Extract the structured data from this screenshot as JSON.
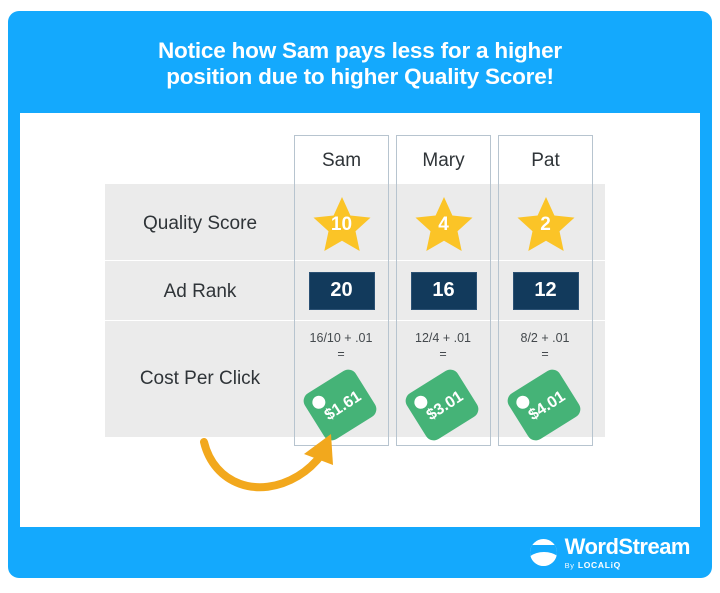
{
  "header": {
    "title_line1": "Notice how Sam pays less for a higher",
    "title_line2": "position due to higher Quality Score!"
  },
  "colors": {
    "brand_blue": "#14a9fd",
    "band_gray": "#ebebeb",
    "star_yellow": "#fbc427",
    "rank_navy": "#123a5c",
    "tag_green": "#45b377",
    "arrow_orange": "#f2a81d",
    "border_gray": "#b7c4cf"
  },
  "table": {
    "columns": [
      {
        "name": "Sam"
      },
      {
        "name": "Mary"
      },
      {
        "name": "Pat"
      }
    ],
    "rows": [
      {
        "label": "Quality Score",
        "type": "star",
        "values": [
          "10",
          "4",
          "2"
        ]
      },
      {
        "label": "Ad Rank",
        "type": "rank",
        "values": [
          "20",
          "16",
          "12"
        ]
      },
      {
        "label": "Cost Per Click",
        "type": "cpc",
        "formulas": [
          "16/10 + .01\n=",
          "12/4 + .01\n=",
          "8/2 + .01\n="
        ],
        "formula_lines": [
          {
            "expr": "16/10 + .01",
            "eq": "="
          },
          {
            "expr": "12/4 + .01",
            "eq": "="
          },
          {
            "expr": "8/2 + .01",
            "eq": "="
          }
        ],
        "values": [
          "$1.61",
          "$3.01",
          "$4.01"
        ]
      }
    ]
  },
  "annotation": {
    "arrow": "curved-arrow-pointing-to-sam-cost"
  },
  "footer": {
    "logo_name": "WordStream",
    "logo_by": "By",
    "logo_parent": "LOCALiQ"
  }
}
